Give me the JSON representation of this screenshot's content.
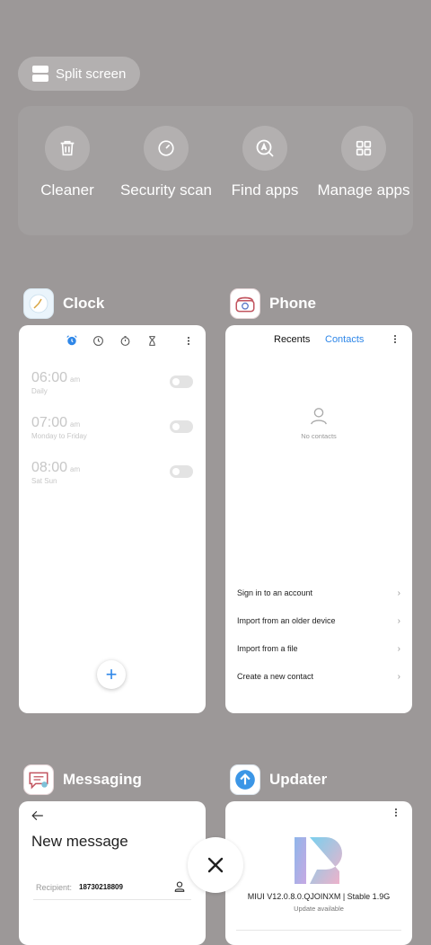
{
  "split_screen": {
    "label": "Split screen",
    "icon": "split-screen-icon"
  },
  "quick_actions": [
    {
      "label": "Cleaner",
      "icon": "trash-icon"
    },
    {
      "label": "Security scan",
      "icon": "security-scan-icon"
    },
    {
      "label": "Find apps",
      "icon": "find-apps-icon"
    },
    {
      "label": "Manage apps",
      "icon": "grid-icon"
    }
  ],
  "apps": {
    "clock": {
      "name": "Clock",
      "alarms": [
        {
          "time": "06:00",
          "ampm": "am",
          "repeat": "Daily"
        },
        {
          "time": "07:00",
          "ampm": "am",
          "repeat": "Monday to Friday"
        },
        {
          "time": "08:00",
          "ampm": "am",
          "repeat": "Sat Sun"
        }
      ],
      "fab_label": "+"
    },
    "phone": {
      "name": "Phone",
      "tabs": [
        "Recents",
        "Contacts"
      ],
      "empty_text": "No contacts",
      "actions": [
        "Sign in to an account",
        "Import from an older device",
        "Import from a file",
        "Create a new contact"
      ]
    },
    "messaging": {
      "name": "Messaging",
      "title": "New message",
      "recipient_label": "Recipient:",
      "recipient_value": "18730218809"
    },
    "updater": {
      "name": "Updater",
      "version": "MIUI V12.0.8.0.QJOINXM | Stable 1.9G",
      "status": "Update available"
    }
  },
  "colors": {
    "accent": "#2f87e8",
    "background": "#9c9898"
  }
}
